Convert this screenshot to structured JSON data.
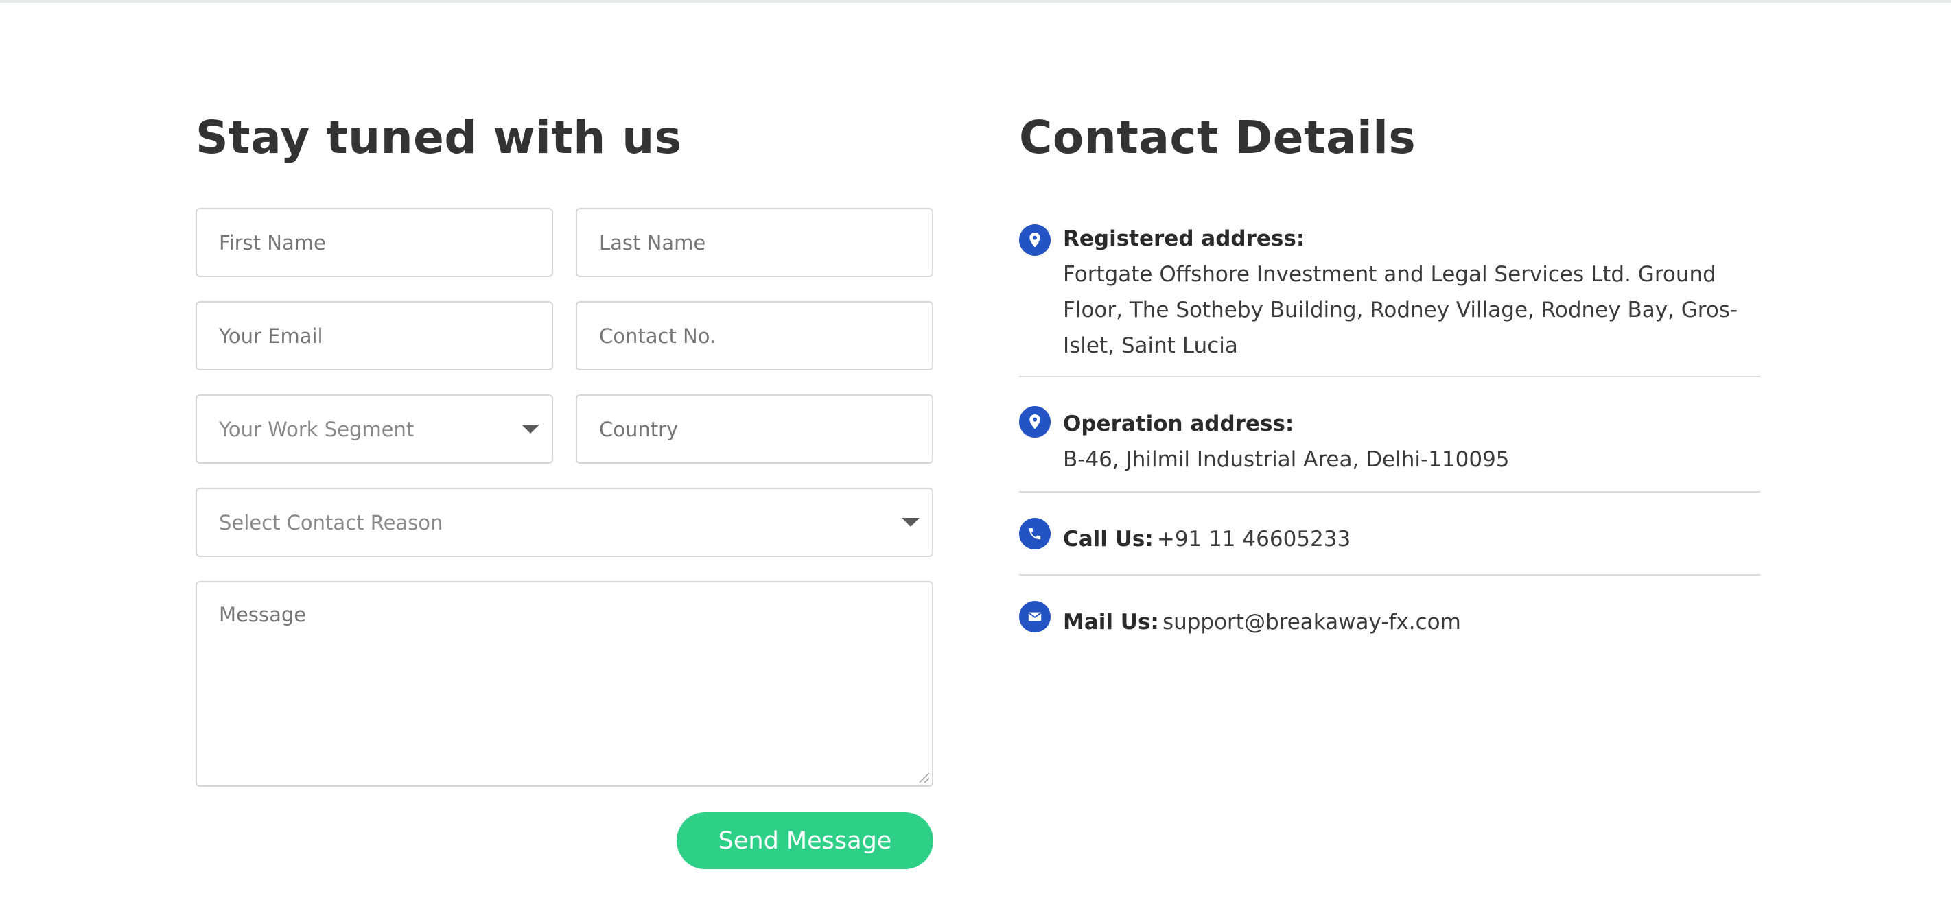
{
  "form": {
    "heading": "Stay tuned with us",
    "first_name_placeholder": "First Name",
    "last_name_placeholder": "Last Name",
    "email_placeholder": "Your Email",
    "contact_placeholder": "Contact No.",
    "work_segment_selected": "Your Work Segment",
    "country_placeholder": "Country",
    "contact_reason_selected": "Select Contact Reason",
    "message_placeholder": "Message",
    "send_label": "Send Message"
  },
  "contact": {
    "heading": "Contact Details",
    "registered": {
      "title": "Registered address:",
      "value": "Fortgate Offshore Investment and Legal Services Ltd. Ground Floor, The Sotheby Building, Rodney Village, Rodney Bay, Gros-Islet, Saint Lucia",
      "icon": "location-pin-icon"
    },
    "operation": {
      "title": "Operation address:",
      "value": "B-46, Jhilmil Industrial Area, Delhi-110095",
      "icon": "location-pin-icon"
    },
    "call": {
      "title": "Call Us:",
      "value": "+91 11 46605233",
      "icon": "phone-icon"
    },
    "mail": {
      "title": "Mail Us:",
      "value": "support@breakaway-fx.com",
      "icon": "envelope-icon"
    }
  },
  "colors": {
    "accent_blue": "#2453c4",
    "button_green": "#2ecf86",
    "heading_text": "#333333"
  }
}
